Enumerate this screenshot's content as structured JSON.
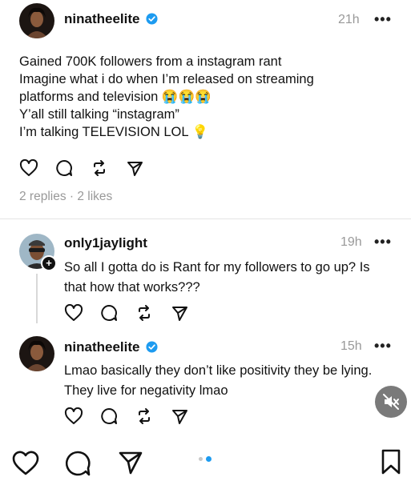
{
  "post": {
    "username": "ninatheelite",
    "time": "21h",
    "more": "•••",
    "lines": [
      "Gained 700K followers from a instagram rant",
      "Imagine what i do when I’m released on streaming",
      "platforms and television 😭😭😭",
      "Y’all still talking “instagram”",
      "I’m talking TELEVISION LOL 💡"
    ],
    "meta": "2 replies · 2 likes"
  },
  "reply1": {
    "username": "only1jaylight",
    "time": "19h",
    "more": "•••",
    "lines": [
      "So all I gotta do is Rant for my followers to go up? Is",
      "that how that works???"
    ]
  },
  "reply2": {
    "username": "ninatheelite",
    "time": "15h",
    "more": "•••",
    "lines": [
      "Lmao basically they don’t like positivity they be lying.",
      "They live for negativity lmao"
    ]
  },
  "icons": [
    "heart-icon",
    "comment-icon",
    "repost-icon",
    "send-icon",
    "mute-icon",
    "bookmark-icon"
  ],
  "colors": {
    "verified": "#1d9bf0",
    "muted": "#999999",
    "mute_button": "#7a7a7a",
    "page_dot_active": "#1d9bf0"
  }
}
